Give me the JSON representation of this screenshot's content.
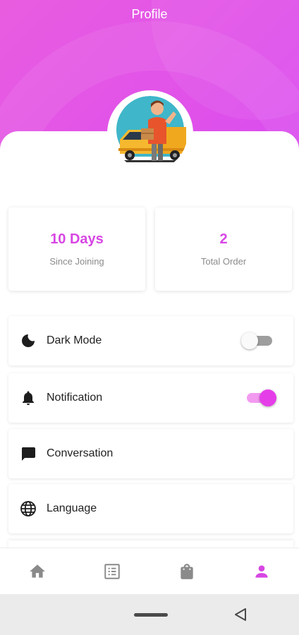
{
  "header": {
    "title": "Profile"
  },
  "stats": [
    {
      "value": "10 Days",
      "label": "Since Joining"
    },
    {
      "value": "2",
      "label": "Total Order"
    }
  ],
  "settings": [
    {
      "label": "Dark Mode",
      "icon": "moon-icon",
      "toggle": false
    },
    {
      "label": "Notification",
      "icon": "bell-icon",
      "toggle": true
    },
    {
      "label": "Conversation",
      "icon": "chat-icon"
    },
    {
      "label": "Language",
      "icon": "globe-icon"
    }
  ],
  "bottom_nav": [
    {
      "icon": "home-icon",
      "active": false
    },
    {
      "icon": "list-icon",
      "active": false
    },
    {
      "icon": "shopping-bag-icon",
      "active": false
    },
    {
      "icon": "person-icon",
      "active": true
    }
  ],
  "colors": {
    "accent": "#d746e3",
    "header": "#e152e9",
    "inactive_nav": "#8a8a8a"
  }
}
